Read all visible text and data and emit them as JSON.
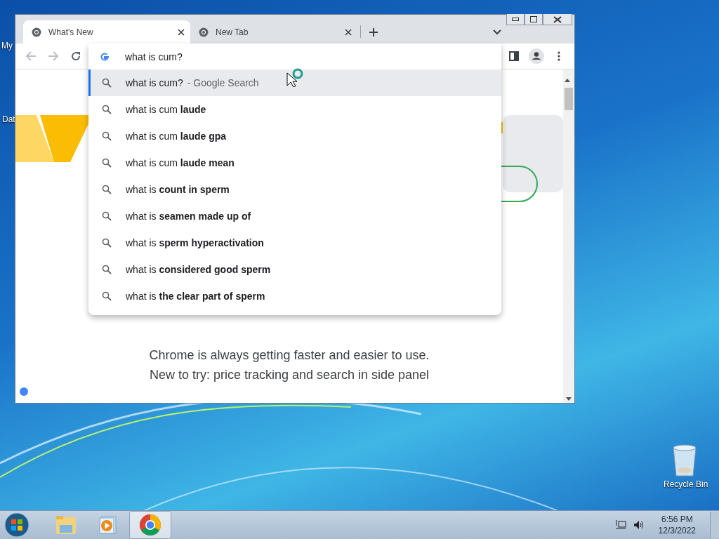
{
  "desktop_icons": [
    {
      "label": "My"
    },
    {
      "label": "Dat"
    },
    {
      "label": "Recycle Bin"
    }
  ],
  "browser": {
    "tabs": [
      {
        "title": "What's New",
        "selected": true
      },
      {
        "title": "New Tab",
        "selected": false
      }
    ],
    "omnibox": {
      "value": "what is cum?"
    },
    "suggestions": [
      {
        "kind": "search",
        "text": "what is cum?",
        "suffix": "- Google Search",
        "selected": true
      },
      {
        "kind": "query",
        "text": "what is cum **laude**",
        "selected": false
      },
      {
        "kind": "query",
        "text": "what is cum **laude gpa**",
        "selected": false
      },
      {
        "kind": "query",
        "text": "what is cum **laude mean**",
        "selected": false
      },
      {
        "kind": "query",
        "text": "what is **count in sperm**",
        "selected": false
      },
      {
        "kind": "query",
        "text": "what is **seamen made up of**",
        "selected": false
      },
      {
        "kind": "query",
        "text": "what is **sperm hyperactivation**",
        "selected": false
      },
      {
        "kind": "query",
        "text": "what is **considered good sperm**",
        "selected": false
      },
      {
        "kind": "query",
        "text": "what is **the clear part of sperm**",
        "selected": false
      }
    ],
    "page": {
      "lines": [
        "Chrome is always getting faster and easier to use.",
        "New to try: price tracking and search in side panel"
      ]
    }
  },
  "taskbar": {
    "apps": [
      {
        "kind": "explorer",
        "selected": false
      },
      {
        "kind": "media",
        "selected": false
      },
      {
        "kind": "chrome",
        "selected": true
      }
    ],
    "time": "6:56 PM",
    "date": "12/3/2022"
  }
}
